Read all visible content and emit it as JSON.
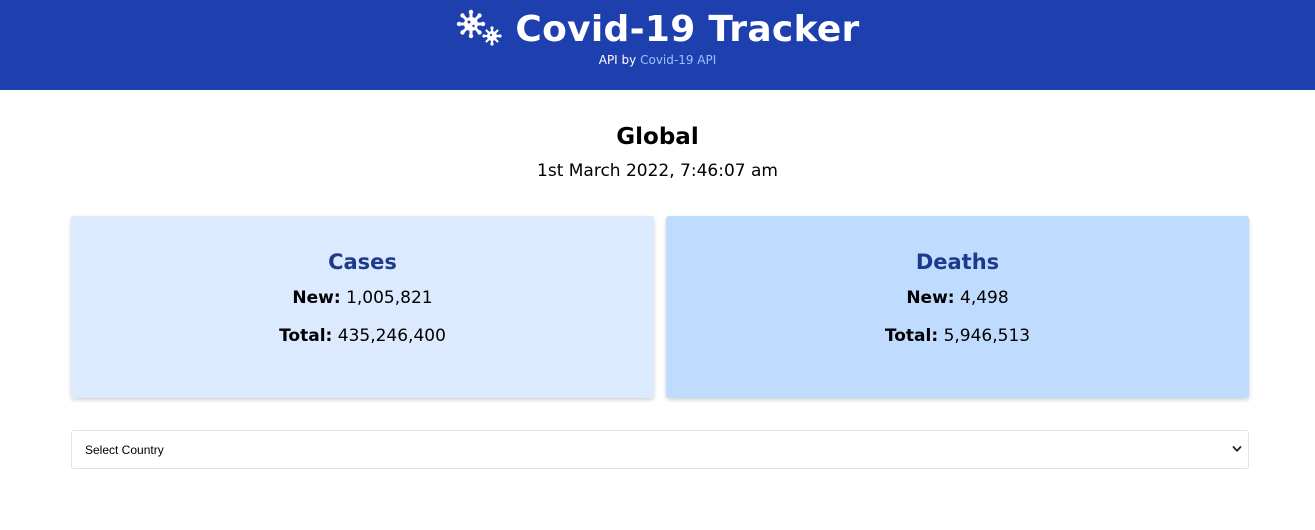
{
  "header": {
    "title": "Covid-19 Tracker",
    "api_prefix": "API by",
    "api_link_text": "Covid-19 API",
    "logo_icon": "virus-icon"
  },
  "global": {
    "region": "Global",
    "updated": "1st March 2022, 7:46:07 am"
  },
  "cards": {
    "cases": {
      "title": "Cases",
      "new_label": "New:",
      "new_value": "1,005,821",
      "total_label": "Total:",
      "total_value": "435,246,400"
    },
    "deaths": {
      "title": "Deaths",
      "new_label": "New:",
      "new_value": "4,498",
      "total_label": "Total:",
      "total_value": "5,946,513"
    }
  },
  "country_select": {
    "selected": "Select Country",
    "icon": "chevron-down-icon"
  },
  "colors": {
    "header_bg": "#1e40af",
    "cases_bg": "#dbeafe",
    "deaths_bg": "#bfdbfe",
    "card_title": "#1e3a8a",
    "link": "#93c5fd"
  }
}
